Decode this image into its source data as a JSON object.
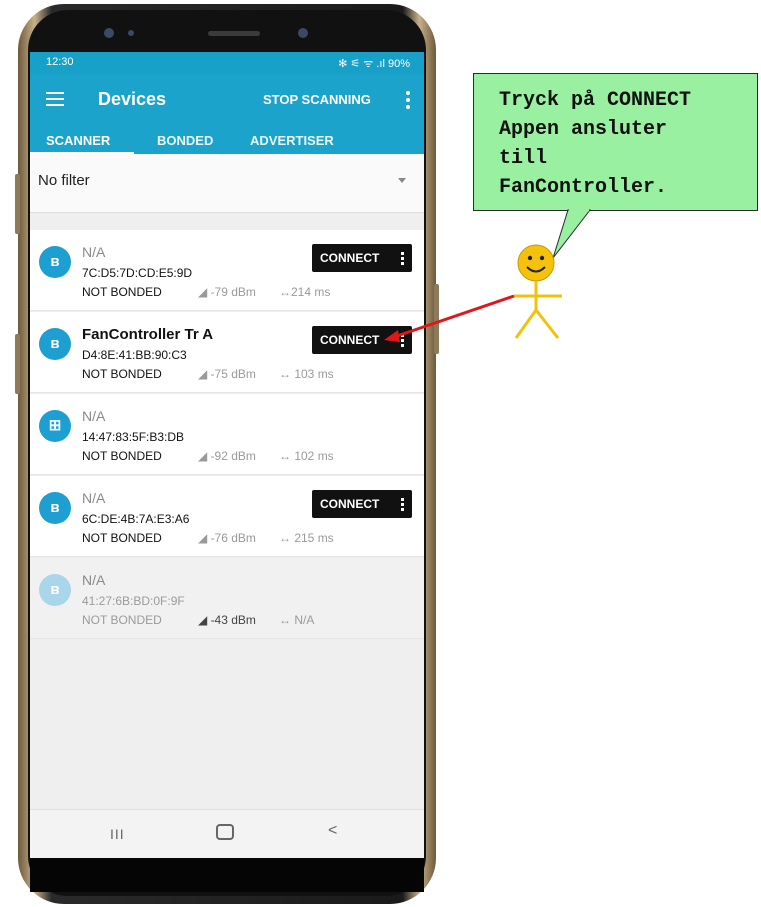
{
  "status_bar": {
    "time": "12:30",
    "icons_text": "✻ ⚟ ᯤ .ıl 90%",
    "battery": "90%"
  },
  "app_bar": {
    "title": "Devices",
    "action": "STOP SCANNING"
  },
  "tabs": [
    {
      "label": "SCANNER",
      "active": true
    },
    {
      "label": "BONDED",
      "active": false
    },
    {
      "label": "ADVERTISER",
      "active": false
    }
  ],
  "filter": {
    "label": "No filter"
  },
  "devices": [
    {
      "name": "N/A",
      "mac": "7C:D5:7D:CD:E5:9D",
      "bond": "NOT BONDED",
      "rssi": "◢ -79 dBm",
      "interval": "↔214 ms",
      "connect": "CONNECT",
      "icon": "bluetooth-icon"
    },
    {
      "name": "FanController Tr A",
      "mac": "D4:8E:41:BB:90:C3",
      "bond": "NOT BONDED",
      "rssi": "◢ -75 dBm",
      "interval": "↔ 103 ms",
      "connect": "CONNECT",
      "icon": "bluetooth-icon"
    },
    {
      "name": "N/A",
      "mac": "14:47:83:5F:B3:DB",
      "bond": "NOT BONDED",
      "rssi": "◢ -92 dBm",
      "interval": "↔ 102 ms",
      "icon": "windows-icon"
    },
    {
      "name": "N/A",
      "mac": "6C:DE:4B:7A:E3:A6",
      "bond": "NOT BONDED",
      "rssi": "◢ -76 dBm",
      "interval": "↔ 215 ms",
      "connect": "CONNECT",
      "icon": "bluetooth-icon"
    },
    {
      "name": "N/A",
      "mac": "41:27:6B:BD:0F:9F",
      "bond": "NOT BONDED",
      "rssi": "◢ -43 dBm",
      "interval": "↔ N/A",
      "icon": "bluetooth-icon"
    }
  ],
  "nav": {
    "recent": "III",
    "back": "<"
  },
  "callout": {
    "text": "Tryck på CONNECT\nAppen ansluter\ntill\nFanController."
  },
  "colors": {
    "accent": "#1ca3cb",
    "bubble": "#98f0a0",
    "arrow": "#e0161b",
    "smiley": "#f4c20d"
  }
}
